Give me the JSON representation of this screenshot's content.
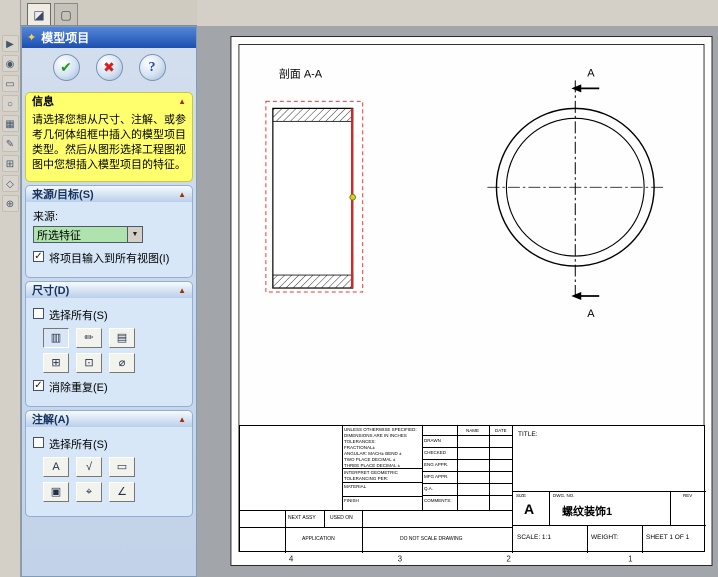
{
  "colors": {
    "panel_header_blue": "#1c4fae",
    "info_yellow": "#ffff6e",
    "selection_red": "#ee1c1c",
    "dropdown_green": "#aee3ae",
    "groupbox_blue": "#d7e7f8"
  },
  "ui": {
    "collapse_glyph": "▲",
    "dropdown_glyph": "▼",
    "check_glyph": "✓"
  },
  "tabs": [
    {
      "glyph": "◪"
    },
    {
      "glyph": "▢"
    }
  ],
  "side_toolbar": [
    {
      "glyph": "▶"
    },
    {
      "glyph": "◉"
    },
    {
      "glyph": "▭"
    },
    {
      "glyph": "○"
    },
    {
      "glyph": "▦"
    },
    {
      "glyph": "✎"
    },
    {
      "glyph": "⊞"
    },
    {
      "glyph": "◇"
    },
    {
      "glyph": "⊕"
    }
  ],
  "panel": {
    "title": "模型项目",
    "title_icon_glyph": "✦",
    "ok_glyph": "✔",
    "cancel_glyph": "✖",
    "help_glyph": "?",
    "info": {
      "header": "信息",
      "message": "请选择您想从尺寸、注解、或参考几何体组框中插入的模型项目类型。然后从图形选择工程图视图中您想插入模型项目的特征。"
    },
    "source": {
      "header": "来源/目标(S)",
      "label": "来源:",
      "value": "所选特征",
      "import_all": "将项目输入到所有视图(I)"
    },
    "dimensions": {
      "header": "尺寸(D)",
      "select_all": "选择所有(S)",
      "eliminate_duplicates": "消除重复(E)",
      "icons": [
        {
          "glyph": "▥"
        },
        {
          "glyph": "✏"
        },
        {
          "glyph": "▤"
        },
        {
          "glyph": "⊞"
        },
        {
          "glyph": "⊡"
        },
        {
          "glyph": "⌀"
        }
      ]
    },
    "annotations": {
      "header": "注解(A)",
      "select_all": "选择所有(S)",
      "icons": [
        {
          "glyph": "A"
        },
        {
          "glyph": "√"
        },
        {
          "glyph": "▭"
        },
        {
          "glyph": "▣"
        },
        {
          "glyph": "⌖"
        },
        {
          "glyph": "∠"
        }
      ]
    }
  },
  "drawing": {
    "section_view_label": "剖面 A-A",
    "section_marker": "A",
    "zones": [
      "4",
      "3",
      "2",
      "1"
    ],
    "title_block": {
      "spec_lines": [
        "UNLESS OTHERWISE SPECIFIED:",
        "DIMENSIONS ARE IN INCHES",
        "TOLERANCES:",
        "FRACTIONAL±",
        "ANGULAR: MACH±  BEND ±",
        "TWO PLACE DECIMAL    ±",
        "THREE PLACE DECIMAL  ±"
      ],
      "interpret_lines": [
        "INTERPRET GEOMETRIC",
        "TOLERANCING PER:"
      ],
      "material_label": "MATERIAL",
      "finish_label": "FINISH",
      "next_assy": "NEXT ASSY",
      "used_on": "USED ON",
      "application": "APPLICATION",
      "do_not_scale": "DO NOT SCALE DRAWING",
      "name_header": "NAME",
      "date_header": "DATE",
      "rows": [
        "DRAWN",
        "CHECKED",
        "ENG APPR.",
        "MFG APPR.",
        "Q.A.",
        "COMMENTS:"
      ],
      "title_label": "TITLE:",
      "size_label": "SIZE",
      "size_value": "A",
      "dwg_no_label": "DWG. NO.",
      "dwg_no_value": "螺纹装饰1",
      "rev_label": "REV",
      "scale": "SCALE: 1:1",
      "weight": "WEIGHT:",
      "sheet": "SHEET 1 OF 1"
    }
  }
}
